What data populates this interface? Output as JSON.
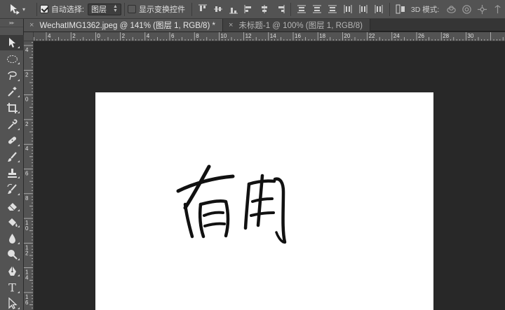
{
  "options_bar": {
    "auto_select_label": "自动选择:",
    "auto_select_checked": true,
    "auto_select_target": "图层",
    "show_transform_label": "显示变换控件",
    "show_transform_checked": false,
    "mode_3d_label": "3D 模式:"
  },
  "tabs": [
    {
      "close": "×",
      "title": "WechatIMG1362.jpeg @ 141% (图层 1, RGB/8) *"
    },
    {
      "close": "×",
      "title": "未标题-1 @ 100% (图层 1, RGB/8)"
    }
  ],
  "rulers": {
    "top_labels": [
      "4",
      "2",
      "0",
      "2",
      "4",
      "6",
      "8",
      "10",
      "12",
      "14",
      "16",
      "18",
      "20",
      "22",
      "24",
      "26",
      "28",
      "30"
    ],
    "left_labels": [
      "4",
      "2",
      "0",
      "2",
      "4",
      "6",
      "8",
      "10",
      "12",
      "14",
      "16"
    ]
  },
  "tools": [
    "move-tool-icon",
    "marquee-tool-icon",
    "lasso-tool-icon",
    "magic-wand-tool-icon",
    "crop-tool-icon",
    "eyedropper-tool-icon",
    "healing-brush-tool-icon",
    "brush-tool-icon",
    "clone-stamp-tool-icon",
    "history-brush-tool-icon",
    "eraser-tool-icon",
    "paint-bucket-tool-icon",
    "blur-tool-icon",
    "dodge-tool-icon",
    "pen-tool-icon",
    "type-tool-icon",
    "path-selection-tool-icon"
  ],
  "colors": {
    "ui_dark": "#535353",
    "canvas_bg": "#282828",
    "document_bg": "#ffffff",
    "stroke": "#111111"
  }
}
